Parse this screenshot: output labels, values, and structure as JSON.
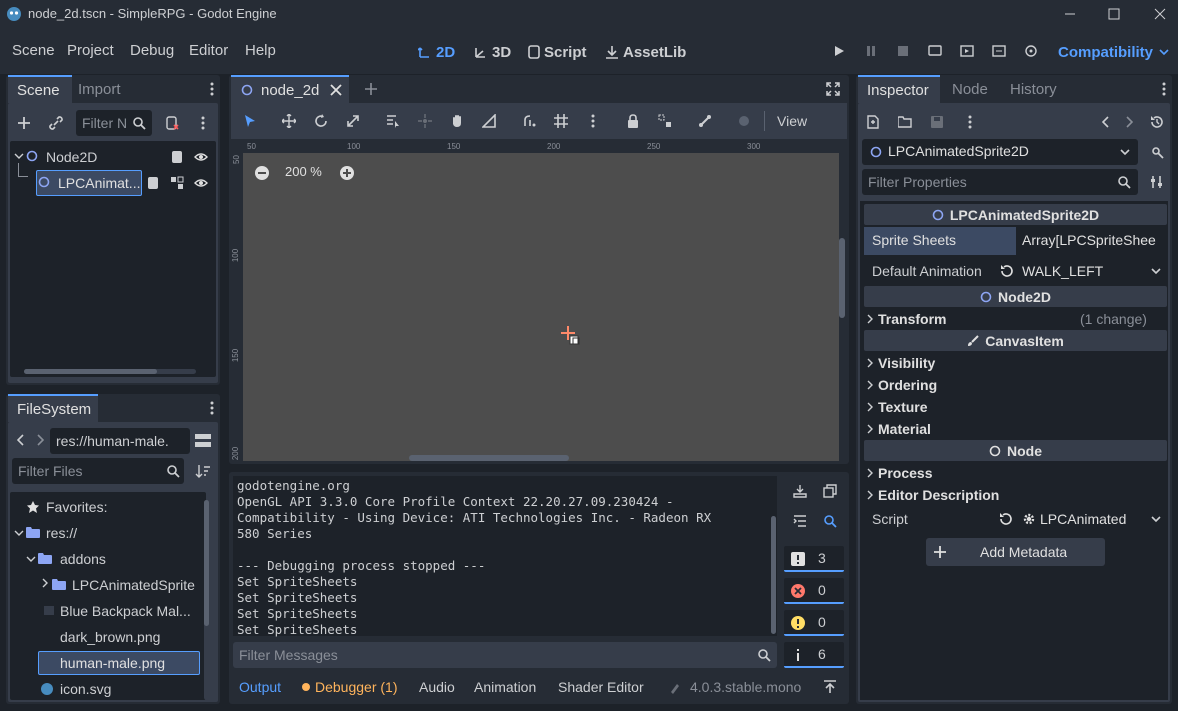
{
  "window": {
    "title": "node_2d.tscn - SimpleRPG - Godot Engine"
  },
  "menu": {
    "items": [
      "Scene",
      "Project",
      "Debug",
      "Editor",
      "Help"
    ]
  },
  "workspaces": {
    "items": [
      "2D",
      "3D",
      "Script",
      "AssetLib"
    ],
    "active": "2D"
  },
  "renderer": {
    "label": "Compatibility"
  },
  "scene_dock": {
    "tabs": [
      "Scene",
      "Import"
    ],
    "filter_placeholder": "Filter N",
    "tree": [
      {
        "label": "Node2D"
      },
      {
        "label": "LPCAnimat..."
      }
    ]
  },
  "filesystem": {
    "tab": "FileSystem",
    "path": "res://human-male.",
    "filter_placeholder": "Filter Files",
    "items": [
      {
        "label": "Favorites:"
      },
      {
        "label": "res://"
      },
      {
        "label": "addons"
      },
      {
        "label": "LPCAnimatedSprite"
      },
      {
        "label": "Blue Backpack Mal..."
      },
      {
        "label": "dark_brown.png"
      },
      {
        "label": "human-male.png"
      },
      {
        "label": "icon.svg"
      }
    ]
  },
  "editor": {
    "tab": "node_2d",
    "zoom": "200 %",
    "view_label": "View",
    "ruler_h": [
      "50",
      "100",
      "150",
      "200",
      "250",
      "300"
    ],
    "ruler_v": [
      "50",
      "100",
      "150",
      "200"
    ]
  },
  "output": {
    "lines": [
      "godotengine.org",
      "OpenGL API 3.3.0 Core Profile Context 22.20.27.09.230424 -",
      "Compatibility - Using Device: ATI Technologies Inc. - Radeon RX",
      "580 Series",
      "",
      "--- Debugging process stopped ---",
      "Set SpriteSheets",
      "Set SpriteSheets",
      "Set SpriteSheets",
      "Set SpriteSheets"
    ],
    "filter_placeholder": "Filter Messages",
    "counts": [
      "3",
      "0",
      "0",
      "6"
    ]
  },
  "bottom_tabs": {
    "items": [
      "Output",
      "Debugger (1)",
      "Audio",
      "Animation",
      "Shader Editor"
    ],
    "version": "4.0.3.stable.mono"
  },
  "inspector": {
    "tabs": [
      "Inspector",
      "Node",
      "History"
    ],
    "object": "LPCAnimatedSprite2D",
    "filter_placeholder": "Filter Properties",
    "class_header": "LPCAnimatedSprite2D",
    "sprite_sheets_label": "Sprite Sheets",
    "sprite_sheets_value": "Array[LPCSpriteShee",
    "default_anim_label": "Default Animation",
    "default_anim_value": "WALK_LEFT",
    "node2d_header": "Node2D",
    "transform_label": "Transform",
    "transform_note": "(1 change)",
    "canvasitem_header": "CanvasItem",
    "canvas_sections": [
      "Visibility",
      "Ordering",
      "Texture",
      "Material"
    ],
    "node_header": "Node",
    "node_sections": [
      "Process",
      "Editor Description"
    ],
    "script_label": "Script",
    "script_value": "LPCAnimated",
    "add_metadata": "Add Metadata"
  },
  "colors": {
    "accent": "#569eff",
    "bg": "#262c35",
    "dark": "#1d2229",
    "viewport": "#4d4d4d"
  }
}
